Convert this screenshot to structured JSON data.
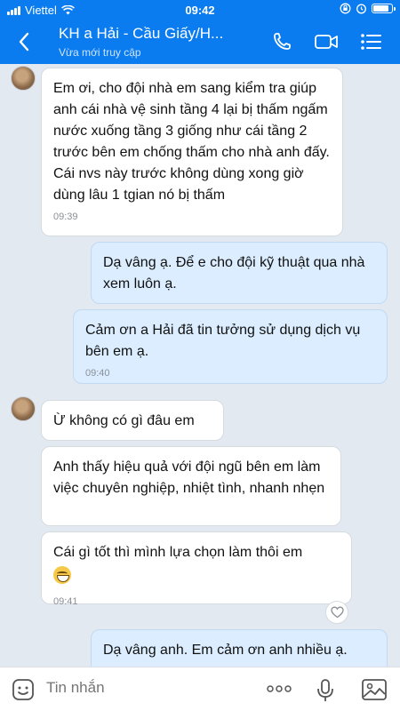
{
  "status": {
    "carrier": "Viettel",
    "time": "09:42"
  },
  "header": {
    "title": "KH a Hải - Cầu Giấy/H...",
    "subtitle": "Vừa mới truy cập",
    "icons": [
      "back-chevron-icon",
      "phone-icon",
      "video-call-icon",
      "menu-icon"
    ]
  },
  "messages": [
    {
      "dir": "in",
      "text": "Em ơi, cho đội nhà em sang kiểm tra giúp anh cái nhà vệ sinh tầng 4 lại bị thấm ngấm nước xuống tầng 3 giống như cái tầng 2 trước bên em chống thấm cho nhà anh đấy. Cái nvs này trước không dùng xong giờ dùng lâu 1 tgian nó bị thấm",
      "time": "09:39"
    },
    {
      "dir": "out",
      "text": "Dạ vâng ạ. Để e cho đội kỹ thuật qua nhà xem luôn ạ."
    },
    {
      "dir": "out",
      "text": "Cảm ơn a Hải đã tin tưởng sử dụng dịch vụ bên em ạ.",
      "time": "09:40"
    },
    {
      "dir": "in",
      "text": "Ừ không có gì đâu em"
    },
    {
      "dir": "in",
      "text": "Anh thấy hiệu quả với đội ngũ bên em làm việc chuyên nghiệp, nhiệt tình, nhanh nhẹn"
    },
    {
      "dir": "in",
      "text": "Cái gì tốt thì mình lựa chọn làm thôi em",
      "emoji": "grinning-face-emoji",
      "time": "09:41"
    },
    {
      "dir": "out",
      "text": "Dạ vâng anh. Em cảm ơn anh nhiều ạ."
    }
  ],
  "input": {
    "placeholder": "Tin nhắn"
  },
  "colors": {
    "brand": "#0a7cf0",
    "outgoing_bubble": "#dbedfe",
    "incoming_bubble": "#ffffff",
    "background": "#e2e9f1"
  }
}
